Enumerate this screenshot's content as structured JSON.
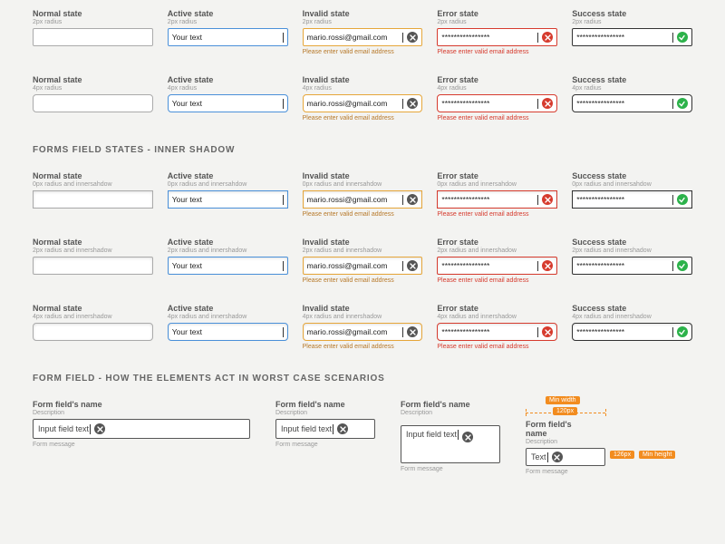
{
  "states": {
    "normal": {
      "label": "Normal state",
      "value": "",
      "helper": ""
    },
    "active": {
      "label": "Active state",
      "value": "Your text",
      "helper": ""
    },
    "invalid": {
      "label": "Invalid state",
      "value": "mario.rossi@gmail.com",
      "helper": "Please enter valid email address"
    },
    "error": {
      "label": "Error state",
      "value": "****************",
      "helper": "Please enter valid email address"
    },
    "success": {
      "label": "Success state",
      "value": "****************",
      "helper": ""
    }
  },
  "radii_top": [
    {
      "sub": "2px radius",
      "cls": "r2"
    },
    {
      "sub": "4px radius",
      "cls": "r4"
    }
  ],
  "section_inner": "FORMS FIELD STATES - INNER SHADOW",
  "radii_inner": [
    {
      "sub": "0px radius and innersahdow",
      "cls": "r0 ins"
    },
    {
      "sub": "2px radius and innershadow",
      "cls": "r2 ins"
    },
    {
      "sub": "4px radius and innershadow",
      "cls": "r4 ins"
    }
  ],
  "section_worst": "FORM FIELD - HOW THE ELEMENTS ACT IN WORST CASE SCENARIOS",
  "worst": {
    "w1": {
      "name": "Form field's name",
      "desc": "Description",
      "value": "Input field text",
      "msg": "Form message"
    },
    "w2": {
      "name": "Form field's name",
      "desc": "Description",
      "value": "Input field text",
      "msg": "Form message"
    },
    "w3": {
      "name": "Form field's name",
      "desc": "Description",
      "value": "Input field text",
      "msg": "Form message"
    },
    "w4": {
      "name": "Form field's name",
      "desc": "Description",
      "value": "Text",
      "msg": "Form message"
    },
    "anno_min_width": "Min width",
    "anno_width_val": "120px",
    "anno_min_height": "Min height",
    "anno_height_val": "126px"
  }
}
